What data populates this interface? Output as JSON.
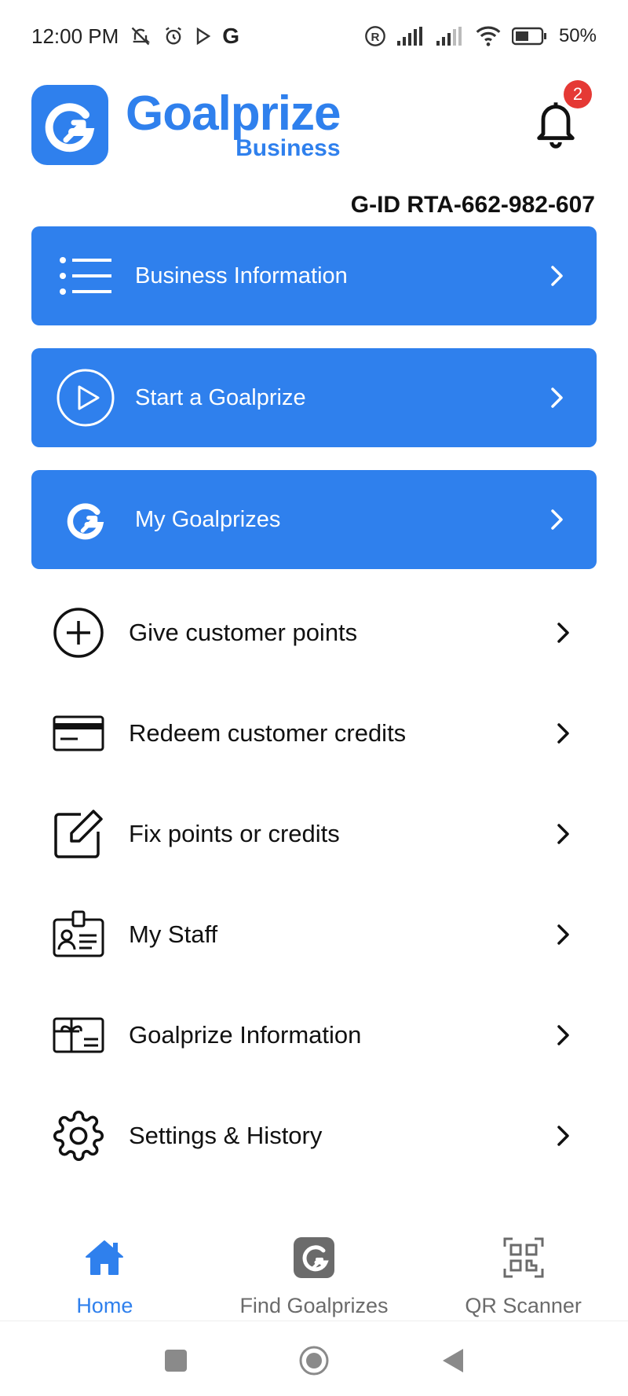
{
  "status_bar": {
    "time": "12:00 PM",
    "battery": "50%"
  },
  "header": {
    "brand_name": "Goalprize",
    "brand_sub": "Business",
    "notification_count": "2"
  },
  "gid": "G-ID RTA-662-982-607",
  "cards": [
    {
      "label": "Business Information",
      "icon": "list-icon"
    },
    {
      "label": "Start a Goalprize",
      "icon": "play-circle-icon"
    },
    {
      "label": "My Goalprizes",
      "icon": "goalprize-logo-icon"
    }
  ],
  "menu": [
    {
      "label": "Give customer points",
      "icon": "plus-circle-icon"
    },
    {
      "label": "Redeem customer credits",
      "icon": "credit-card-icon"
    },
    {
      "label": "Fix points or credits",
      "icon": "edit-icon"
    },
    {
      "label": "My Staff",
      "icon": "staff-badge-icon"
    },
    {
      "label": "Goalprize Information",
      "icon": "gift-card-icon"
    },
    {
      "label": "Settings & History",
      "icon": "gear-icon"
    }
  ],
  "bottom_nav": [
    {
      "label": "Home",
      "icon": "home-icon",
      "active": true
    },
    {
      "label": "Find Goalprizes",
      "icon": "goalprize-logo-icon",
      "active": false
    },
    {
      "label": "QR Scanner",
      "icon": "qr-code-icon",
      "active": false
    }
  ],
  "colors": {
    "accent": "#2f80ed",
    "badge": "#e53935",
    "inactive": "#6b6b6b"
  }
}
